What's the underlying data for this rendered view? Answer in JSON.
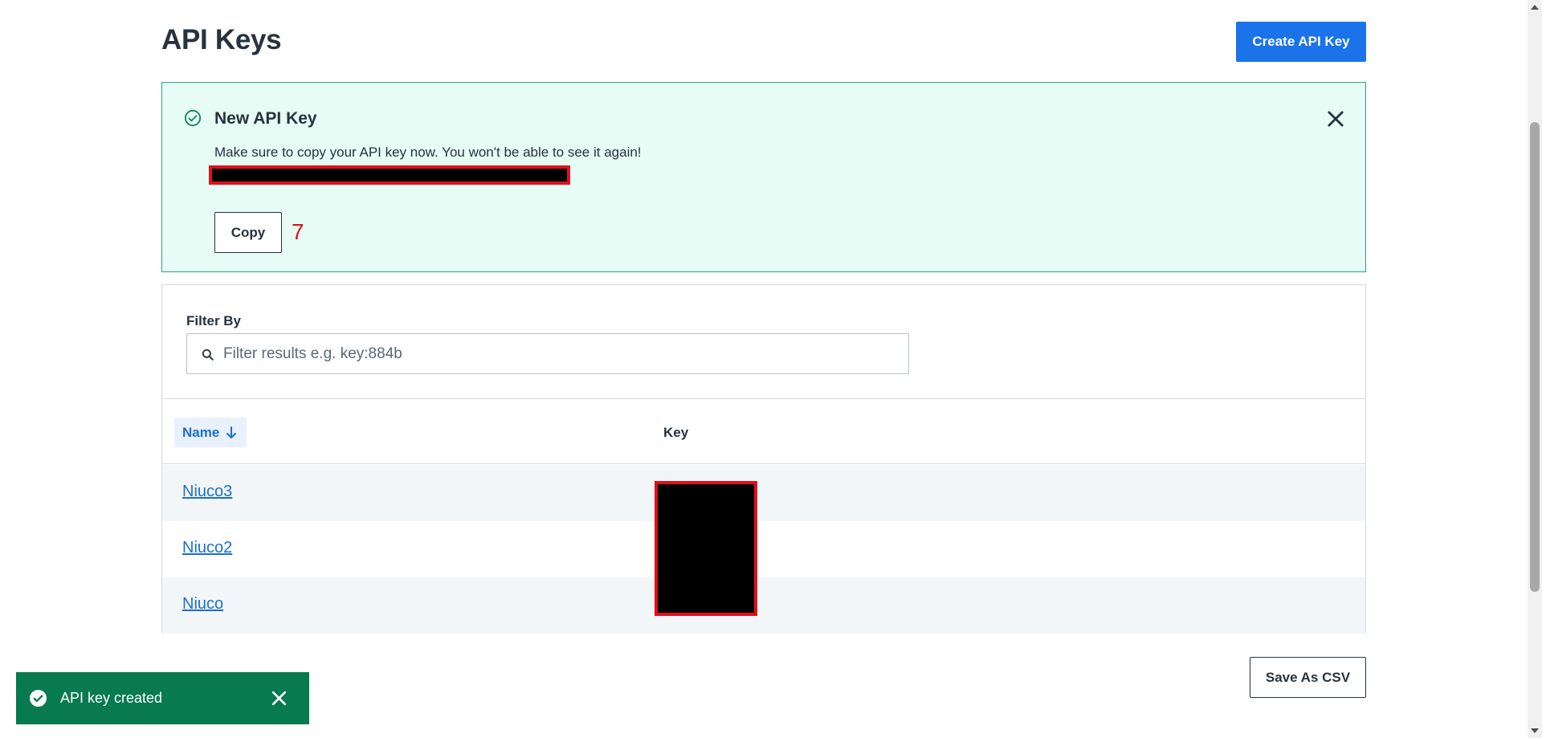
{
  "header": {
    "title": "API Keys",
    "create_button": "Create API Key"
  },
  "banner": {
    "title": "New API Key",
    "message": "Make sure to copy your API key now. You won't be able to see it again!",
    "copy_button": "Copy",
    "marker": "7",
    "status_color": "#2aa877"
  },
  "filter": {
    "label": "Filter By",
    "placeholder": "Filter results e.g. key:884b"
  },
  "table": {
    "columns": [
      "Name",
      "Key"
    ],
    "rows": [
      {
        "name": "Niuco3"
      },
      {
        "name": "Niuco2"
      },
      {
        "name": "Niuco"
      }
    ]
  },
  "actions": {
    "save_csv": "Save As CSV"
  },
  "toast": {
    "message": "API key created",
    "color": "#077a4f"
  },
  "colors": {
    "accent": "#1a73e8",
    "redaction_border": "#e0101a"
  }
}
